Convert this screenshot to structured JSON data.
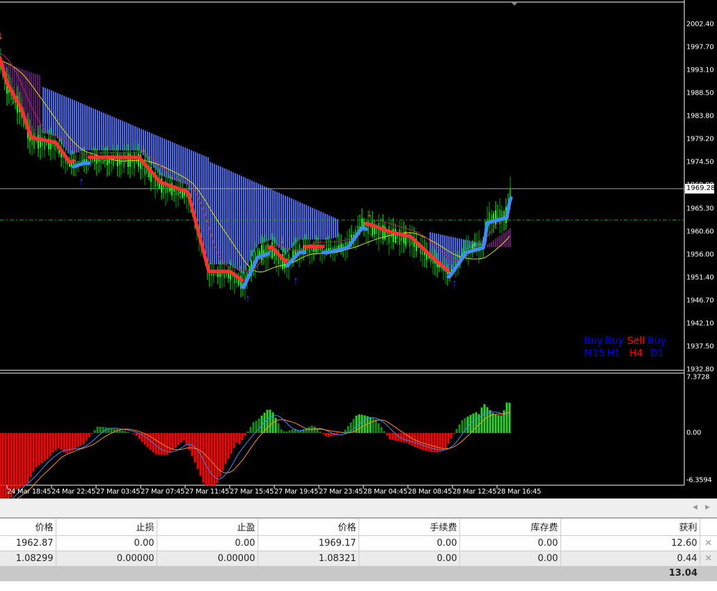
{
  "price_axis": [
    "2002.40",
    "1997.70",
    "1993.10",
    "1988.50",
    "1983.80",
    "1979.20",
    "1974.50",
    "1969.90",
    "1965.30",
    "1960.60",
    "1956.00",
    "1951.40",
    "1946.70",
    "1942.10",
    "1937.50",
    "1932.80"
  ],
  "current_price": "1969.28",
  "indicator_axis": {
    "top": "7.3728",
    "zero": "0.00",
    "bottom": "-6.3594"
  },
  "time_axis": [
    "24 Mar 18:45",
    "24 Mar 22:45",
    "27 Mar 03:45",
    "27 Mar 07:45",
    "27 Mar 11:45",
    "27 Mar 15:45",
    "27 Mar 19:45",
    "27 Mar 23:45",
    "28 Mar 04:45",
    "28 Mar 08:45",
    "28 Mar 12:45",
    "28 Mar 16:45"
  ],
  "signals": {
    "signal": [
      "Buy",
      "Buy",
      "Sell",
      "Buy"
    ],
    "timeframe": [
      "M15",
      "H1",
      "H4",
      "D1"
    ],
    "buy_color": "#0000ff",
    "sell_color": "#ff0000"
  },
  "trades": {
    "headers": [
      "价格",
      "止损",
      "止盈",
      "价格",
      "手续费",
      "库存费",
      "获利"
    ],
    "rows": [
      [
        "1962.87",
        "0.00",
        "0.00",
        "1969.17",
        "0.00",
        "0.00",
        "12.60"
      ],
      [
        "1.08299",
        "0.00000",
        "0.00000",
        "1.08321",
        "0.00",
        "0.00",
        "0.44"
      ]
    ],
    "total": "13.04"
  }
}
